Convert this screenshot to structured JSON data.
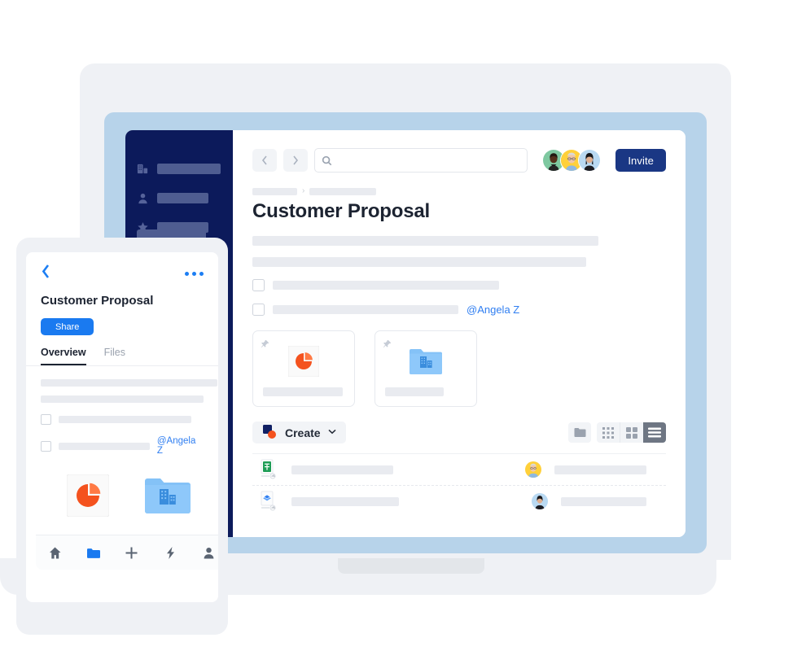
{
  "laptop": {
    "sidebar": {
      "items": [
        {
          "icon": "building-icon",
          "label": ""
        },
        {
          "icon": "person-icon",
          "label": ""
        },
        {
          "icon": "star-icon",
          "label": ""
        }
      ],
      "button_label": ""
    },
    "topbar": {
      "back_icon": "chevron-left-icon",
      "forward_icon": "chevron-right-icon",
      "search_icon": "search-icon",
      "search_value": "",
      "search_placeholder": "",
      "avatars": [
        "avatar-green",
        "avatar-yellow",
        "avatar-blue"
      ],
      "invite_label": "Invite"
    },
    "breadcrumb": {
      "separator": "›",
      "items": [
        "",
        ""
      ]
    },
    "title": "Customer Proposal",
    "paragraphs": [
      "",
      ""
    ],
    "todos": [
      {
        "checked": false,
        "text": "",
        "mention": ""
      },
      {
        "checked": false,
        "text": "",
        "mention": "@Angela Z"
      }
    ],
    "cards": [
      {
        "pin_icon": "pin-icon",
        "thumb": "pie-chart-icon",
        "caption": ""
      },
      {
        "pin_icon": "pin-icon",
        "thumb": "company-folder-icon",
        "caption": ""
      }
    ],
    "toolbar": {
      "create_logo": "dropbox-create-logo",
      "create_label": "Create",
      "create_caret": "∨",
      "views": [
        {
          "name": "folder-view-icon",
          "active": false
        },
        {
          "name": "dense-grid-view-icon",
          "active": false
        },
        {
          "name": "grid-view-icon",
          "active": false
        },
        {
          "name": "list-view-icon",
          "active": true
        }
      ]
    },
    "file_rows": [
      {
        "file_icon": "google-sheets-icon",
        "name": "",
        "avatar": "avatar-yellow",
        "owner": ""
      },
      {
        "file_icon": "dropbox-paper-icon",
        "name": "",
        "avatar": "avatar-blue",
        "owner": ""
      }
    ]
  },
  "phone": {
    "back_icon": "chevron-left-icon",
    "more_icon": "more-horizontal-icon",
    "title": "Customer Proposal",
    "share_label": "Share",
    "tabs": [
      {
        "label": "Overview",
        "active": true
      },
      {
        "label": "Files",
        "active": false
      }
    ],
    "paragraphs": [
      "",
      ""
    ],
    "todos": [
      {
        "checked": false,
        "text": "",
        "mention": ""
      },
      {
        "checked": false,
        "text": "",
        "mention": "@Angela Z"
      }
    ],
    "thumbs": [
      "pie-chart-icon",
      "company-folder-icon"
    ],
    "nav": [
      {
        "name": "home-icon",
        "active": false
      },
      {
        "name": "folder-icon",
        "active": true
      },
      {
        "name": "plus-icon",
        "active": false
      },
      {
        "name": "bolt-icon",
        "active": false
      },
      {
        "name": "person-icon",
        "active": false
      }
    ]
  },
  "colors": {
    "sidebar_navy": "#0c1a5b",
    "invite_navy": "#1a3784",
    "share_blue": "#1a7af0",
    "mention_blue": "#2f7ef1",
    "bezel_blue": "#b7d3ea",
    "chassis_gray": "#eff1f5",
    "accent_orange": "#f4521e"
  }
}
